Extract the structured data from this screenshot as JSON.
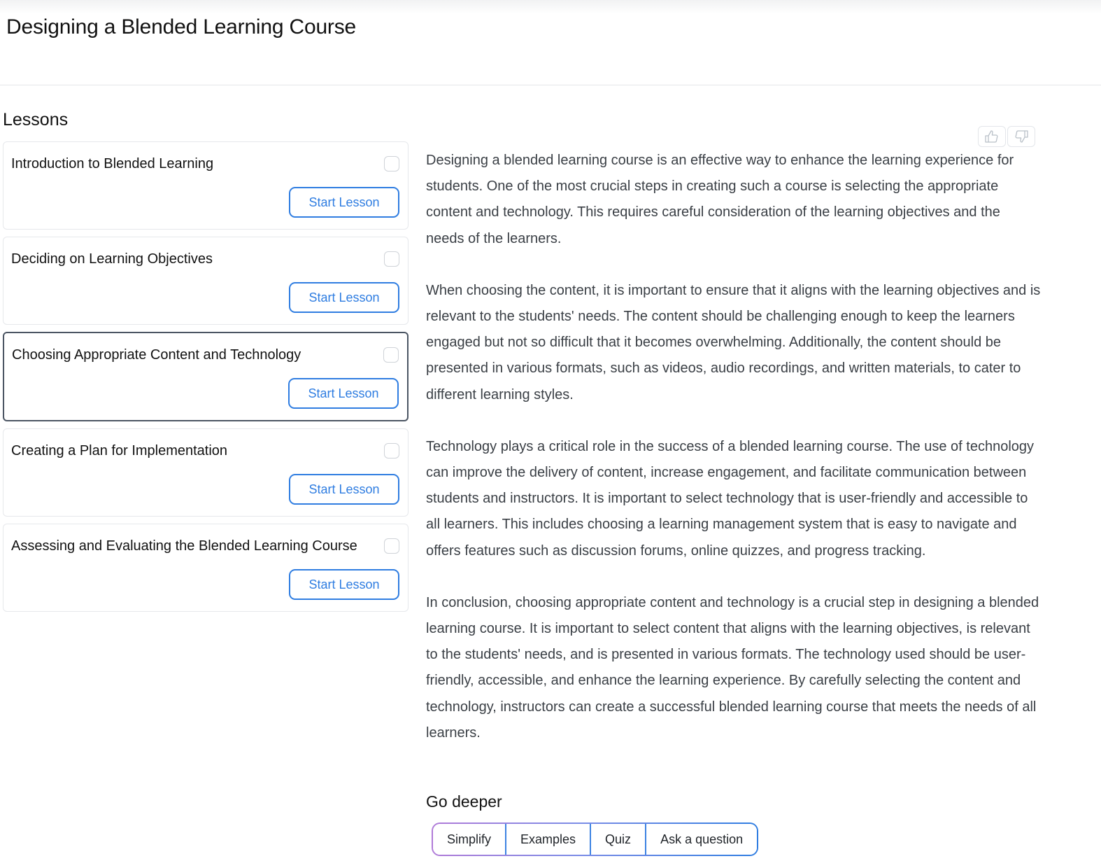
{
  "header": {
    "title": "Designing a Blended Learning Course"
  },
  "sidebar": {
    "heading": "Lessons",
    "lessons": [
      {
        "title": "Introduction to Blended Learning",
        "button": "Start Lesson",
        "checked": false,
        "active": false
      },
      {
        "title": "Deciding on Learning Objectives",
        "button": "Start Lesson",
        "checked": false,
        "active": false
      },
      {
        "title": "Choosing Appropriate Content and Technology",
        "button": "Start Lesson",
        "checked": false,
        "active": true
      },
      {
        "title": "Creating a Plan for Implementation",
        "button": "Start Lesson",
        "checked": false,
        "active": false
      },
      {
        "title": "Assessing and Evaluating the Blended Learning Course",
        "button": "Start Lesson",
        "checked": false,
        "active": false
      }
    ]
  },
  "feedback": {
    "icons": [
      "thumbs-up-icon",
      "thumbs-down-icon"
    ]
  },
  "main": {
    "paragraphs": [
      "Designing a blended learning course is an effective way to enhance the learning experience for students. One of the most crucial steps in creating such a course is selecting the appropriate content and technology. This requires careful consideration of the learning objectives and the needs of the learners.",
      "When choosing the content, it is important to ensure that it aligns with the learning objectives and is relevant to the students' needs. The content should be challenging enough to keep the learners engaged but not so difficult that it becomes overwhelming. Additionally, the content should be presented in various formats, such as videos, audio recordings, and written materials, to cater to different learning styles.",
      "Technology plays a critical role in the success of a blended learning course. The use of technology can improve the delivery of content, increase engagement, and facilitate communication between students and instructors. It is important to select technology that is user-friendly and accessible to all learners. This includes choosing a learning management system that is easy to navigate and offers features such as discussion forums, online quizzes, and progress tracking.",
      "In conclusion, choosing appropriate content and technology is a crucial step in designing a blended learning course. It is important to select content that aligns with the learning objectives, is relevant to the students' needs, and is presented in various formats. The technology used should be user-friendly, accessible, and enhance the learning experience. By carefully selecting the content and technology, instructors can create a successful blended learning course that meets the needs of all learners."
    ],
    "go_deeper": {
      "heading": "Go deeper",
      "buttons": [
        "Simplify",
        "Examples",
        "Quiz",
        "Ask a question"
      ]
    }
  },
  "colors": {
    "accent": "#2f7de1",
    "active_border": "#4b5563",
    "gradient_start": "#b07ad8"
  }
}
